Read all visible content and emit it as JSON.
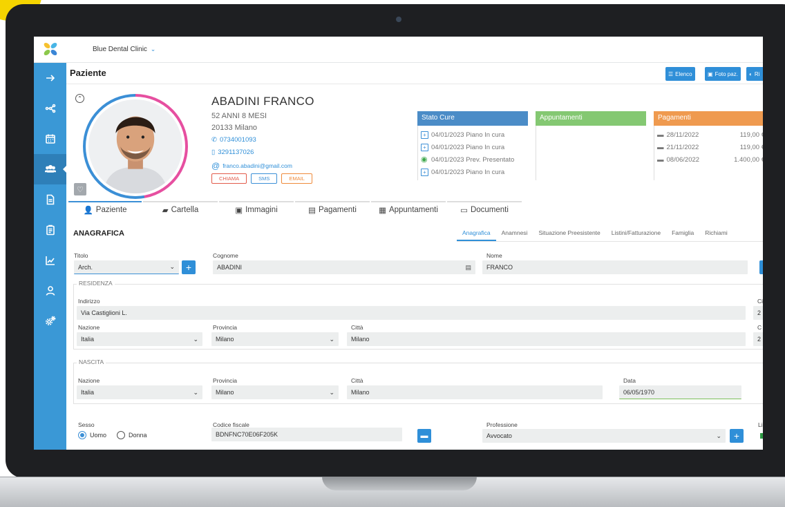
{
  "topbar": {
    "clinic_name": "Blue Dental Clinic"
  },
  "header": {
    "title": "Paziente",
    "btn_elenco": "Elenco",
    "btn_foto": "Foto paz.",
    "btn_r": "Ri"
  },
  "patient": {
    "name": "ABADINI FRANCO",
    "age": "52 ANNI 8 MESI",
    "city": "20133 Milano",
    "phone": "0734001093",
    "mobile": "3291137026",
    "email": "franco.abadini@gmail.com",
    "btn_chiama": "CHIAMA",
    "btn_sms": "SMS",
    "btn_email": "EMAIL"
  },
  "colors": {
    "stato": "#4b8cc7",
    "appuntamenti": "#84c872",
    "pagamenti": "#ef9a4f",
    "primary": "#2f8fd8"
  },
  "stato_cure": {
    "title": "Stato Cure",
    "rows": [
      "04/01/2023 Piano In cura",
      "04/01/2023 Piano In cura",
      "04/01/2023 Prev. Presentato",
      "04/01/2023 Piano In cura"
    ]
  },
  "appuntamenti": {
    "title": "Appuntamenti"
  },
  "pagamenti": {
    "title": "Pagamenti",
    "rows": [
      {
        "date": "28/11/2022",
        "amount": "119,00 €"
      },
      {
        "date": "21/11/2022",
        "amount": "119,00 €"
      },
      {
        "date": "08/06/2022",
        "amount": "1.400,00 €"
      }
    ]
  },
  "tabs": [
    "Paziente",
    "Cartella",
    "Immagini",
    "Pagamenti",
    "Appuntamenti",
    "Documenti"
  ],
  "anagrafica": {
    "title": "ANAGRAFICA",
    "subtabs": [
      "Anagrafica",
      "Anamnesi",
      "Situazione Preesistente",
      "Listini/Fatturazione",
      "Famiglia",
      "Richiami"
    ],
    "titolo_label": "Titolo",
    "titolo_value": "Arch.",
    "cognome_label": "Cognome",
    "cognome_value": "ABADINI",
    "nome_label": "Nome",
    "nome_value": "FRANCO",
    "residenza": {
      "legend": "RESIDENZA",
      "indirizzo_label": "Indirizzo",
      "indirizzo_value": "Via Castiglioni L.",
      "nazione_label": "Nazione",
      "nazione_value": "Italia",
      "provincia_label": "Provincia",
      "provincia_value": "Milano",
      "citta_label": "Città",
      "citta_value": "Milano",
      "ci_label": "Ci",
      "ci_value": "2",
      "ca_label": "C",
      "ca_value": "2"
    },
    "nascita": {
      "legend": "NASCITA",
      "nazione_label": "Nazione",
      "nazione_value": "Italia",
      "provincia_label": "Provincia",
      "provincia_value": "Milano",
      "citta_label": "Città",
      "citta_value": "Milano",
      "data_label": "Data",
      "data_value": "06/05/1970"
    },
    "sesso_label": "Sesso",
    "sesso_uomo": "Uomo",
    "sesso_donna": "Donna",
    "cf_label": "Codice fiscale",
    "cf_value": "BDNFNC70E06F205K",
    "prof_label": "Professione",
    "prof_value": "Avvocato",
    "li_label": "Li"
  }
}
